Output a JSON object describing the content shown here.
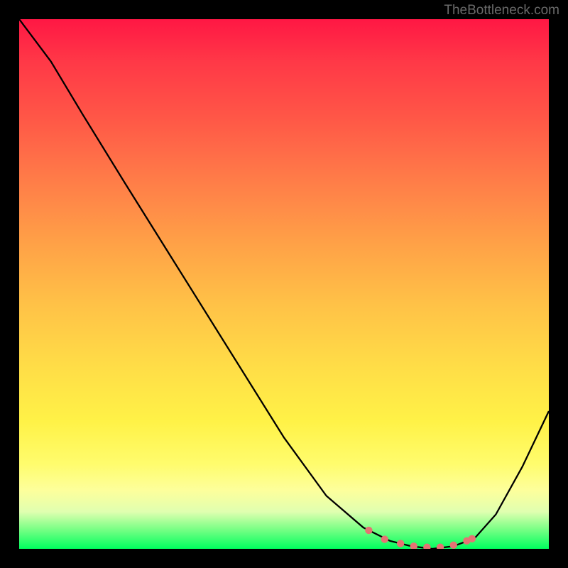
{
  "watermark": "TheBottleneck.com",
  "chart_data": {
    "type": "line",
    "title": "",
    "xlabel": "",
    "ylabel": "",
    "xlim": [
      0,
      1
    ],
    "ylim": [
      0,
      1
    ],
    "series": [
      {
        "name": "curve",
        "x": [
          0.0,
          0.06,
          0.12,
          0.2,
          0.3,
          0.4,
          0.5,
          0.58,
          0.65,
          0.7,
          0.74,
          0.78,
          0.82,
          0.86,
          0.9,
          0.95,
          1.0
        ],
        "y": [
          1.0,
          0.92,
          0.82,
          0.69,
          0.53,
          0.37,
          0.21,
          0.1,
          0.04,
          0.015,
          0.005,
          0.0,
          0.005,
          0.02,
          0.065,
          0.155,
          0.26
        ]
      }
    ],
    "markers": {
      "name": "dots",
      "x": [
        0.66,
        0.69,
        0.72,
        0.745,
        0.77,
        0.795,
        0.82,
        0.845,
        0.855
      ],
      "y": [
        0.035,
        0.018,
        0.01,
        0.005,
        0.003,
        0.003,
        0.007,
        0.015,
        0.019
      ]
    }
  }
}
